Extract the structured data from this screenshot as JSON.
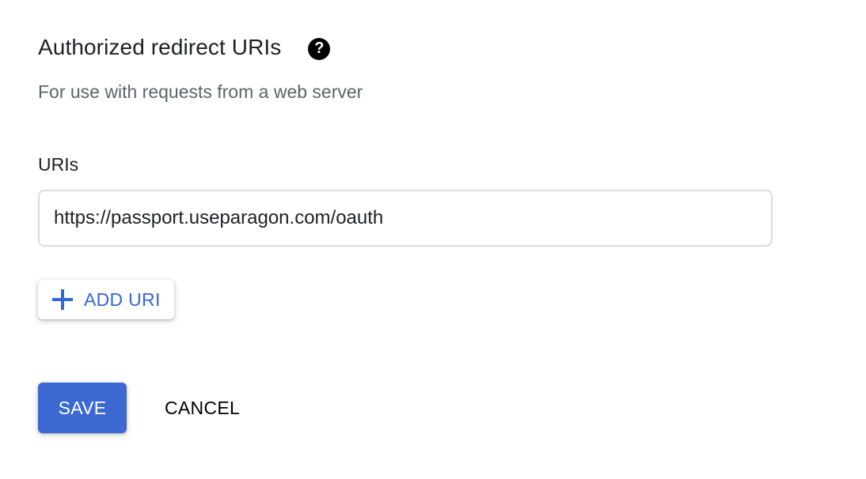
{
  "section": {
    "title": "Authorized redirect URIs",
    "help_icon": "help-circle-icon",
    "description": "For use with requests from a web server"
  },
  "uris": {
    "label": "URIs",
    "items": [
      {
        "value": "https://passport.useparagon.com/oauth"
      }
    ]
  },
  "add_uri": {
    "icon": "plus-icon",
    "label": "ADD URI"
  },
  "actions": {
    "save_label": "SAVE",
    "cancel_label": "CANCEL"
  },
  "colors": {
    "primary": "#3b69d1",
    "link": "#3367d6",
    "text": "#202124",
    "secondary_text": "#5f6368",
    "border": "#dadce0"
  }
}
